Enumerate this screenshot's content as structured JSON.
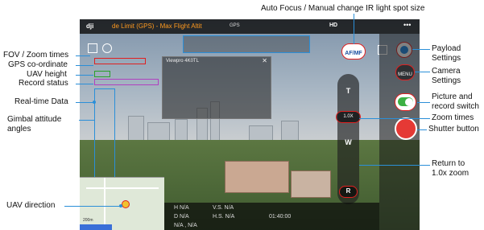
{
  "annotations": {
    "auto_focus": "Auto Focus / Manual change IR light spot size",
    "fov_zoom": "FOV / Zoom times",
    "gps": "GPS co-ordinate",
    "uav_height": "UAV height",
    "record_status": "Record status",
    "realtime_data": "Real-time Data",
    "gimbal_line1": "Gimbal attitude",
    "gimbal_line2": "angles",
    "uav_direction": "UAV direction",
    "payload_line1": "Payload",
    "payload_line2": "Settings",
    "camera_line1": "Camera",
    "camera_line2": "Settings",
    "picture_line1": "Picture and",
    "picture_line2": "record switch",
    "zoom_times": "Zoom times",
    "shutter": "Shutter button",
    "return_line1": "Return to",
    "return_line2": "1.0x zoom"
  },
  "screen": {
    "flight_status": "de Limit (GPS) - Max Flight Altit",
    "gps_label": "GPS",
    "hd_label": "HD",
    "af_mf": "AF/MF",
    "menu": "MENU",
    "zoom_t": "T",
    "zoom_value": "1.0X",
    "zoom_w": "W",
    "zoom_r": "R",
    "panel_title": "Viewpro 4K0TL",
    "map_scale": "200m",
    "h_label": "H",
    "h_value": "N/A",
    "vs_label": "V.S.",
    "vs_value": "N/A",
    "d_label": "D",
    "d_value": "N/A",
    "hs_label": "H.S.",
    "hs_value": "N/A",
    "flight_time": "01:40:00",
    "coords": "N/A , N/A"
  },
  "colors": {
    "annotation_line": "#2b8fd8",
    "highlight_red": "#e02020",
    "switch_green": "#3cb043",
    "shutter_red": "#e53935"
  }
}
